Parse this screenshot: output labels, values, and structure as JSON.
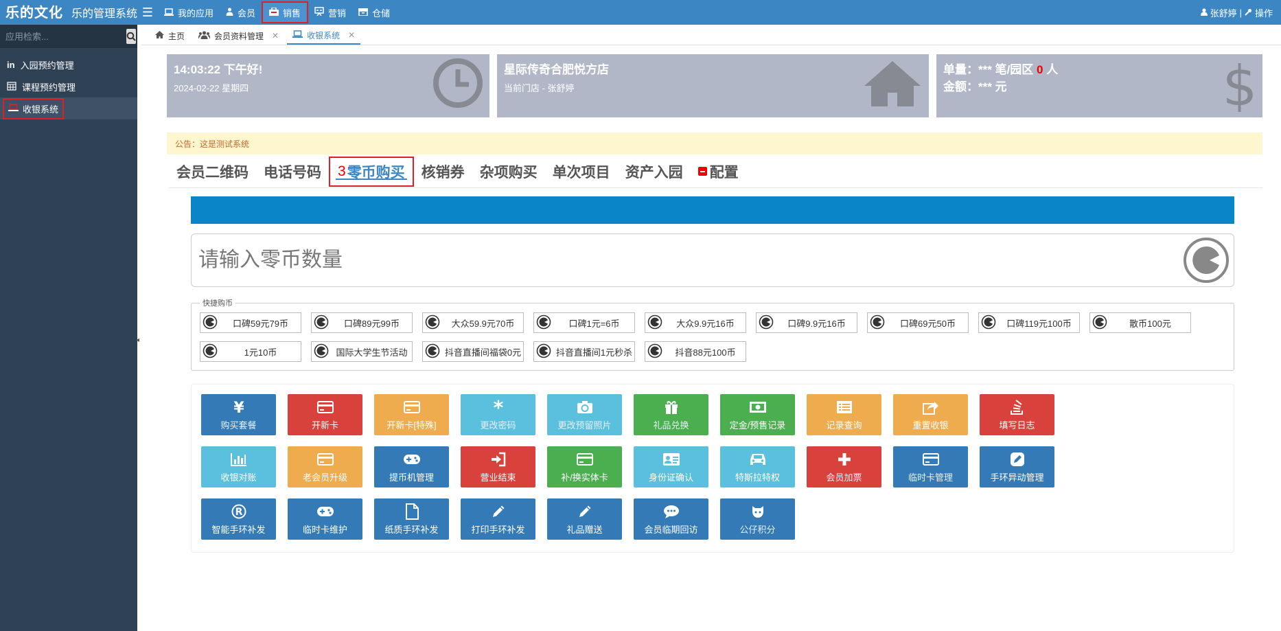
{
  "topbar": {
    "logo": "乐的文化",
    "system_name": "乐的管理系统",
    "nav": [
      {
        "label": "我的应用",
        "icon": "laptop-icon"
      },
      {
        "label": "会员",
        "icon": "user-bag-icon"
      },
      {
        "label": "销售",
        "icon": "sale-icon",
        "active": true
      },
      {
        "label": "营销",
        "icon": "marketing-icon"
      },
      {
        "label": "仓储",
        "icon": "storage-icon"
      }
    ],
    "user": "张舒婷",
    "separator": "|",
    "ops": "操作"
  },
  "sidebar": {
    "search_placeholder": "应用检索...",
    "items": [
      {
        "label": "入园预约管理",
        "icon": "in-icon"
      },
      {
        "label": "课程预约管理",
        "icon": "calendar-icon"
      },
      {
        "label": "收银系统",
        "icon": "laptop-icon",
        "active": true
      }
    ]
  },
  "tabs": [
    {
      "label": "主页",
      "icon": "home-icon"
    },
    {
      "label": "会员资料管理",
      "icon": "users-icon",
      "closable": true
    },
    {
      "label": "收银系统",
      "icon": "laptop-icon",
      "closable": true,
      "active": true
    }
  ],
  "cards": {
    "time": {
      "title": "14:03:22 下午好!",
      "subtitle": "2024-02-22 星期四"
    },
    "store": {
      "title": "星际传奇合肥悦方店",
      "subtitle": "当前门店 - 张舒婷"
    },
    "stats": {
      "line1_prefix": "单量：*** 笔/园区 ",
      "line1_count": "0",
      "line1_suffix": " 人",
      "line2": "金额：*** 元"
    }
  },
  "notice": "公告：这是测试系统",
  "page_tabs": [
    {
      "label": "会员二维码"
    },
    {
      "label": "电话号码"
    },
    {
      "label": "零币购买",
      "num": "3",
      "active": true
    },
    {
      "label": "核销券"
    },
    {
      "label": "杂项购买"
    },
    {
      "label": "单次项目"
    },
    {
      "label": "资产入园"
    },
    {
      "label": "配置",
      "minus": true
    }
  ],
  "coin_input_placeholder": "请输入零币数量",
  "quick": {
    "legend": "快捷购币",
    "items": [
      "口碑59元79币",
      "口碑89元99币",
      "大众59.9元70币",
      "口碑1元=6币",
      "大众9.9元16币",
      "口碑9.9元16币",
      "口碑69元50币",
      "口碑119元100币",
      "散币100元",
      "1元10币",
      "国际大学生节活动",
      "抖音直播间福袋0元",
      "抖音直播间1元秒杀",
      "抖音88元100币"
    ]
  },
  "actions": [
    {
      "label": "购买套餐",
      "color": "blue",
      "icon": "yen-icon",
      "dim": true
    },
    {
      "label": "开新卡",
      "color": "red",
      "icon": "card-icon"
    },
    {
      "label": "开新卡[特殊]",
      "color": "orange",
      "icon": "card-icon"
    },
    {
      "label": "更改密码",
      "color": "cyan",
      "icon": "asterisk-icon",
      "dim": true
    },
    {
      "label": "更改预留照片",
      "color": "cyan",
      "icon": "camera-icon",
      "dim": true
    },
    {
      "label": "礼品兑换",
      "color": "green",
      "icon": "gift-icon",
      "dim": true
    },
    {
      "label": "定金/预售记录",
      "color": "green",
      "icon": "money-icon"
    },
    {
      "label": "记录查询",
      "color": "orange",
      "icon": "list-icon"
    },
    {
      "label": "重置收银",
      "color": "orange",
      "icon": "share-icon"
    },
    {
      "label": "填写日志",
      "color": "red",
      "icon": "stack-icon"
    },
    {
      "label": "收银对账",
      "color": "cyan",
      "icon": "bar-chart-icon"
    },
    {
      "label": "老会员升级",
      "color": "orange",
      "icon": "card-icon"
    },
    {
      "label": "提币机管理",
      "color": "blue",
      "icon": "gamepad-icon"
    },
    {
      "label": "营业结束",
      "color": "red",
      "icon": "sign-in-icon"
    },
    {
      "label": "补/换实体卡",
      "color": "green",
      "icon": "card-icon"
    },
    {
      "label": "身份证确认",
      "color": "cyan",
      "icon": "id-card-icon"
    },
    {
      "label": "特斯拉特权",
      "color": "cyan",
      "icon": "car-icon"
    },
    {
      "label": "会员加票",
      "color": "red",
      "icon": "plus-icon",
      "dim": true
    },
    {
      "label": "临时卡管理",
      "color": "blue",
      "icon": "card-icon",
      "dim": true
    },
    {
      "label": "手环异动管理",
      "color": "blue",
      "icon": "edit-icon"
    },
    {
      "label": "智能手环补发",
      "color": "blue",
      "icon": "registered-icon"
    },
    {
      "label": "临时卡维护",
      "color": "blue",
      "icon": "gamepad-icon"
    },
    {
      "label": "纸质手环补发",
      "color": "blue",
      "icon": "file-icon"
    },
    {
      "label": "打印手环补发",
      "color": "blue",
      "icon": "pencil-icon"
    },
    {
      "label": "礼品赠送",
      "color": "blue",
      "icon": "pencil-icon"
    },
    {
      "label": "会员临期回访",
      "color": "blue",
      "icon": "comment-icon"
    },
    {
      "label": "公仔积分",
      "color": "blue",
      "icon": "github-icon",
      "dim": true
    }
  ]
}
